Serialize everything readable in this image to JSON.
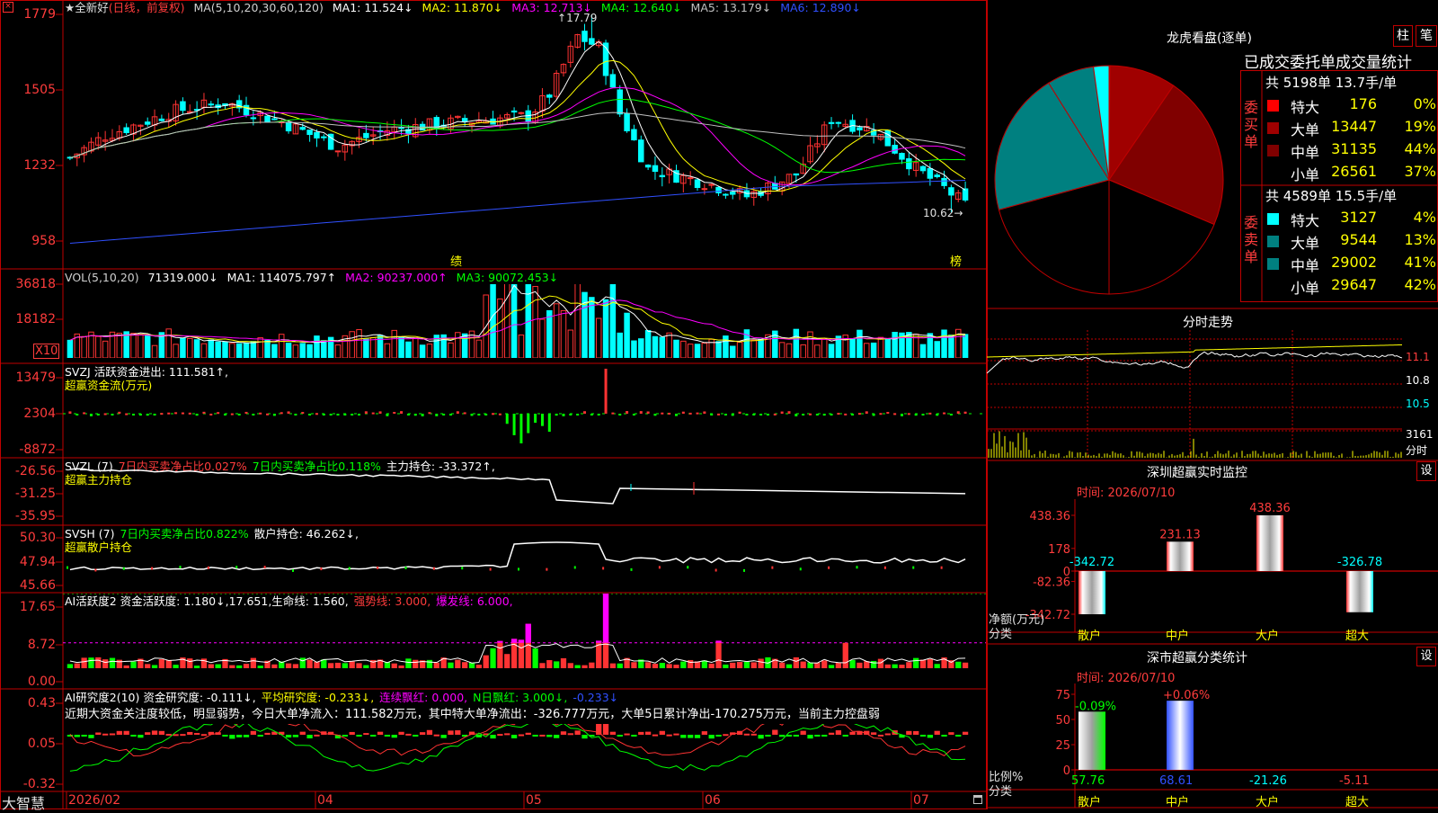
{
  "app": {
    "brand": "大智慧",
    "window_icon": "close-square-icon"
  },
  "colors": {
    "up": "#ff3333",
    "down": "#00ffff",
    "frame": "#c00000",
    "ma1": "#ffffff",
    "ma2": "#ffff00",
    "ma3": "#ff00ff",
    "ma4": "#00ff00",
    "ma5": "#c0c0c0",
    "ma6": "#3050ff"
  },
  "kline": {
    "title_parts": [
      "★全新好",
      "(日线，前复权)",
      "MA(5,10,20,30,60,120)"
    ],
    "ma_labels": [
      "MA1: 11.524↓",
      "MA2: 11.870↓",
      "MA3: 12.713↓",
      "MA4: 12.640↓",
      "MA5: 13.179↓",
      "MA6: 12.890↓"
    ],
    "y_ticks": [
      "1779",
      "1505",
      "1232",
      "958"
    ],
    "high_label": "17.79",
    "low_label": "10.62",
    "markers": [
      "绩",
      "榜"
    ],
    "x_ticks": [
      "2026/02",
      "04",
      "05",
      "06",
      "07"
    ]
  },
  "vol": {
    "title": "VOL(5,10,20)",
    "values": [
      "71319.000↓",
      "MA1: 114075.797↑",
      "MA2: 90237.000↑",
      "MA3: 90072.453↓"
    ],
    "y_ticks": [
      "36818",
      "18182"
    ],
    "unit": "X10"
  },
  "svzj": {
    "title": "SVZJ  活跃资金进出: 111.581↑,",
    "subtitle": "超赢资金流(万元)",
    "y_ticks": [
      "13479",
      "2304",
      "-8872"
    ]
  },
  "svzl": {
    "title": "SVZL (7)",
    "t1": "7日内买卖净占比0.027%",
    "t2": "7日内买卖净占比0.118%",
    "t3": "主力持仓: -33.372↑,",
    "subtitle": "超赢主力持仓",
    "y_ticks": [
      "-26.56",
      "-31.25",
      "-35.95"
    ]
  },
  "svsh": {
    "title": "SVSH (7)",
    "t1": "7日内买卖净占比0.822%",
    "t2": "散户持仓: 46.262↓,",
    "subtitle": "超赢散户持仓",
    "y_ticks": [
      "50.30",
      "47.94",
      "45.66"
    ]
  },
  "ai1": {
    "title": "AI活跃度2 资金活跃度: 1.180↓,17.651,生命线: 1.560,",
    "t_strong": "强势线: 3.000,",
    "t_burst": "爆发线: 6.000,",
    "y_ticks": [
      "17.65",
      "8.72",
      "0.00"
    ]
  },
  "ai2": {
    "title": "AI研究度2(10) 资金研究度: -0.111↓,",
    "t_avg": "平均研究度: -0.233↓,",
    "t_red": "连续飘红: 0.000,",
    "t_nred": "N日飘红: 3.000↓,",
    "t_last": "-0.233↓",
    "comment": "近期大资金关注度较低，明显弱势，今日大单净流入：111.582万元，其中特大单净流出：-326.777万元，大单5日累计净出-170.275万元，当前主力控盘弱",
    "y_ticks": [
      "0.43",
      "0.05",
      "-0.32"
    ]
  },
  "dragon": {
    "title": "龙虎看盘(逐单)",
    "btn_bar": "柱",
    "btn_pen": "笔",
    "subtitle": "已成交委托单成交量统计",
    "buy_label": "委买单",
    "sell_label": "委卖单",
    "buy_total": "共 5198单 13.7手/单",
    "sell_total": "共 4589单 15.5手/单",
    "buy_rows": [
      {
        "name": "特大",
        "value": "176",
        "pct": "0%",
        "color": "#ff0000"
      },
      {
        "name": "大单",
        "value": "13447",
        "pct": "19%",
        "color": "#a00000"
      },
      {
        "name": "中单",
        "value": "31135",
        "pct": "44%",
        "color": "#800000"
      },
      {
        "name": "小单",
        "value": "26561",
        "pct": "37%",
        "color": "#000000"
      }
    ],
    "sell_rows": [
      {
        "name": "特大",
        "value": "3127",
        "pct": "4%",
        "color": "#00ffff"
      },
      {
        "name": "大单",
        "value": "9544",
        "pct": "13%",
        "color": "#008080"
      },
      {
        "name": "中单",
        "value": "29002",
        "pct": "41%",
        "color": "#008080"
      },
      {
        "name": "小单",
        "value": "29647",
        "pct": "42%",
        "color": "#000000"
      }
    ]
  },
  "intraday": {
    "title": "分时走势",
    "labels": [
      "11.1",
      "10.8",
      "10.5",
      "3161",
      "分时"
    ]
  },
  "monitor": {
    "title": "深圳超赢实时监控",
    "btn": "设",
    "time": "时间: 2026/07/10",
    "y_ticks": [
      "438.36",
      "178",
      "0",
      "-82.36",
      "-342.72"
    ],
    "axis_title": [
      "净额(万元)",
      "分类"
    ],
    "cats": [
      "散户",
      "中户",
      "大户",
      "超大"
    ],
    "values": [
      -342.72,
      231.13,
      438.36,
      -326.78
    ],
    "labels": [
      "-342.72",
      "231.13",
      "438.36",
      "-326.78"
    ]
  },
  "classify": {
    "title": "深市超赢分类统计",
    "btn": "设",
    "time": "时间: 2026/07/10",
    "y_ticks": [
      "75",
      "50",
      "25",
      "0"
    ],
    "axis_title": [
      "比例%",
      "分类"
    ],
    "cats": [
      "散户",
      "中户",
      "大户",
      "超大"
    ],
    "top_labels": [
      "-0.09%",
      "+0.06%"
    ],
    "bottom_labels": [
      "57.76",
      "68.61",
      "-21.26",
      "-5.11"
    ],
    "values": [
      57.76,
      68.61,
      -21.26,
      -5.11
    ]
  },
  "chart_data": [
    {
      "type": "candlestick",
      "title": "全新好 (日线，前复权)",
      "y_axis_ticks": [
        17.79,
        15.05,
        12.32,
        9.58
      ],
      "x_labels": [
        "2026/02",
        "04",
        "05",
        "06",
        "07"
      ],
      "annotations": {
        "high": 17.79,
        "low": 10.62
      },
      "ma": {
        "MA1": 11.524,
        "MA2": 11.87,
        "MA3": 12.713,
        "MA4": 12.64,
        "MA5": 13.179,
        "MA6": 12.89
      }
    },
    {
      "type": "bar",
      "title": "VOL(5,10,20)",
      "current": 71319.0,
      "MA1": 114075.797,
      "MA2": 90237.0,
      "MA3": 90072.453,
      "y_axis_ticks": [
        36818,
        18182
      ]
    },
    {
      "type": "bar",
      "title": "超赢资金流(万元)",
      "current": 111.581,
      "y_axis_ticks": [
        13479,
        2304,
        -8872
      ]
    },
    {
      "type": "line",
      "title": "超赢主力持仓",
      "current": -33.372,
      "y_axis_ticks": [
        -26.56,
        -31.25,
        -35.95
      ]
    },
    {
      "type": "line",
      "title": "超赢散户持仓",
      "current": 46.262,
      "y_axis_ticks": [
        50.3,
        47.94,
        45.66
      ]
    },
    {
      "type": "bar",
      "title": "AI活跃度2",
      "current": 1.18,
      "life_line": 1.56,
      "strong_line": 3.0,
      "burst_line": 6.0,
      "y_axis_ticks": [
        17.65,
        8.72,
        0.0
      ]
    },
    {
      "type": "bar",
      "title": "AI研究度2(10)",
      "current": -0.111,
      "average": -0.233,
      "y_axis_ticks": [
        0.43,
        0.05,
        -0.32
      ]
    },
    {
      "type": "pie",
      "title": "龙虎看盘(逐单)",
      "categories": [
        "买特大",
        "买大单",
        "买中单",
        "买小单",
        "卖特大",
        "卖大单",
        "卖中单",
        "卖小单"
      ],
      "values": [
        176,
        13447,
        31135,
        26561,
        3127,
        9544,
        29002,
        29647
      ]
    },
    {
      "type": "bar",
      "title": "深圳超赢实时监控",
      "categories": [
        "散户",
        "中户",
        "大户",
        "超大"
      ],
      "values": [
        -342.72,
        231.13,
        438.36,
        -326.78
      ],
      "ylim": [
        -342.72,
        438.36
      ]
    },
    {
      "type": "bar",
      "title": "深市超赢分类统计",
      "categories": [
        "散户",
        "中户",
        "大户",
        "超大"
      ],
      "values": [
        57.76,
        68.61,
        -21.26,
        -5.11
      ],
      "ylim": [
        0,
        75
      ]
    }
  ]
}
